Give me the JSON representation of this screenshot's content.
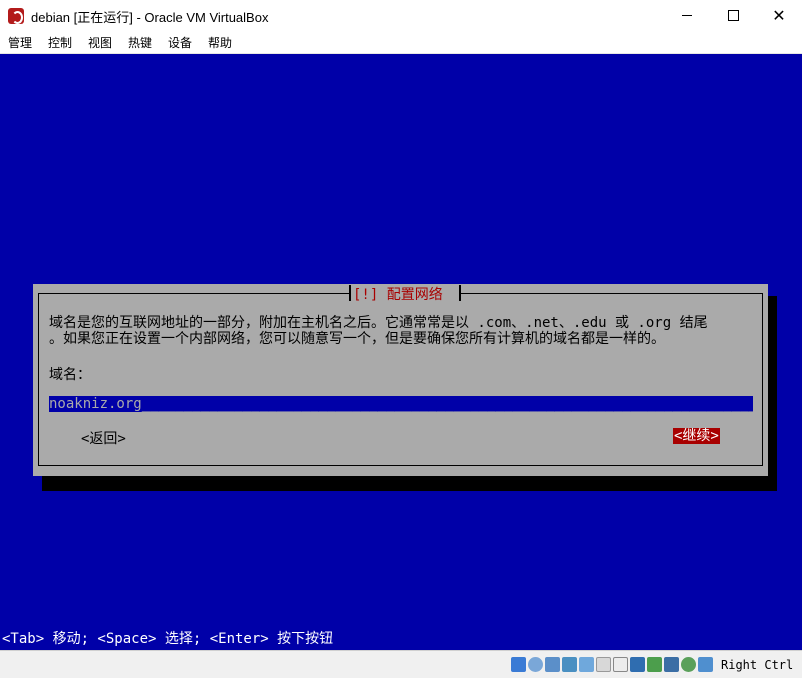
{
  "window": {
    "title": "debian [正在运行] - Oracle VM VirtualBox",
    "minimize_glyph": "",
    "close_glyph": "✕"
  },
  "menu": {
    "items": [
      "管理",
      "控制",
      "视图",
      "热键",
      "设备",
      "帮助"
    ]
  },
  "dialog": {
    "title": "[!] 配置网络",
    "description_line1": "域名是您的互联网地址的一部分，附加在主机名之后。它通常常是以 .com、.net、.edu 或 .org 结尾",
    "description_line2": "。如果您正在设置一个内部网络，您可以随意写一个，但是要确保您所有计算机的域名都是一样的。",
    "field_label": "域名：",
    "field_value": "noakniz.org",
    "back_label": "<返回>",
    "continue_label": "<继续>"
  },
  "helpline": "<Tab> 移动; <Space> 选择; <Enter> 按下按钮",
  "statusbar": {
    "host_key": "Right Ctrl",
    "icons": [
      "storage-icon",
      "optical-drive-icon",
      "audio-icon",
      "network-icon",
      "usb-icon",
      "shared-folder-icon",
      "display-icon",
      "capture-icon",
      "vm-status-icon",
      "cpu-icon",
      "keyboard-capture-icon",
      "mouse-integration-icon"
    ]
  },
  "colors": {
    "guest_background": "#0000a8",
    "dialog_background": "#aaaaaa",
    "accent_red": "#a80000"
  }
}
